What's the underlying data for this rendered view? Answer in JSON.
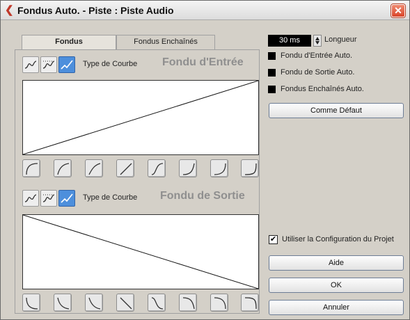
{
  "window": {
    "title": "Fondus Auto. - Piste : Piste Audio",
    "close_symbol": "✕"
  },
  "tabs": [
    {
      "label": "Fondus"
    },
    {
      "label": "Fondus Enchaînés"
    }
  ],
  "fade_in": {
    "curve_type_label": "Type de Courbe",
    "title": "Fondu d'Entrée",
    "selected_curve_type": "spline"
  },
  "fade_out": {
    "curve_type_label": "Type de Courbe",
    "title": "Fondu de Sortie",
    "selected_curve_type": "spline"
  },
  "length": {
    "value": "30 ms",
    "label": "Longueur"
  },
  "options": [
    {
      "label": "Fondu d'Entrée Auto.",
      "checked": false
    },
    {
      "label": "Fondu de Sortie Auto.",
      "checked": false
    },
    {
      "label": "Fondus Enchaînés Auto.",
      "checked": false
    }
  ],
  "buttons": {
    "default": "Comme Défaut",
    "help": "Aide",
    "ok": "OK",
    "cancel": "Annuler"
  },
  "project_config": {
    "label": "Utiliser la Configuration du Projet",
    "checked": true,
    "check_mark": "✔"
  },
  "colors": {
    "selected": "#4d8fdc",
    "close": "#d9452b",
    "title_icon": "#c0392b"
  }
}
